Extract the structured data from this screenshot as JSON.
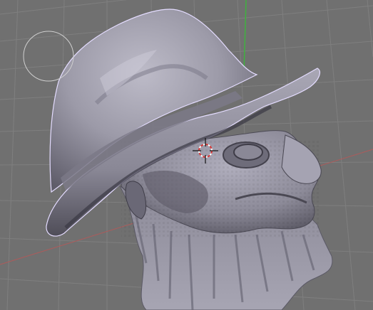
{
  "viewport": {
    "background": "#707070",
    "grid_color": "#7e7e7e",
    "x_axis_color": "#b45a5a",
    "y_axis_color": "#4cb34c"
  },
  "brush": {
    "icon": "sculpt-brush-circle-icon"
  },
  "cursor": {
    "icon": "3d-cursor-icon"
  },
  "mesh": {
    "name": "sculpted-head-with-hat",
    "base_color": "#9a98a6",
    "outline_color": "#e6e0ff"
  }
}
